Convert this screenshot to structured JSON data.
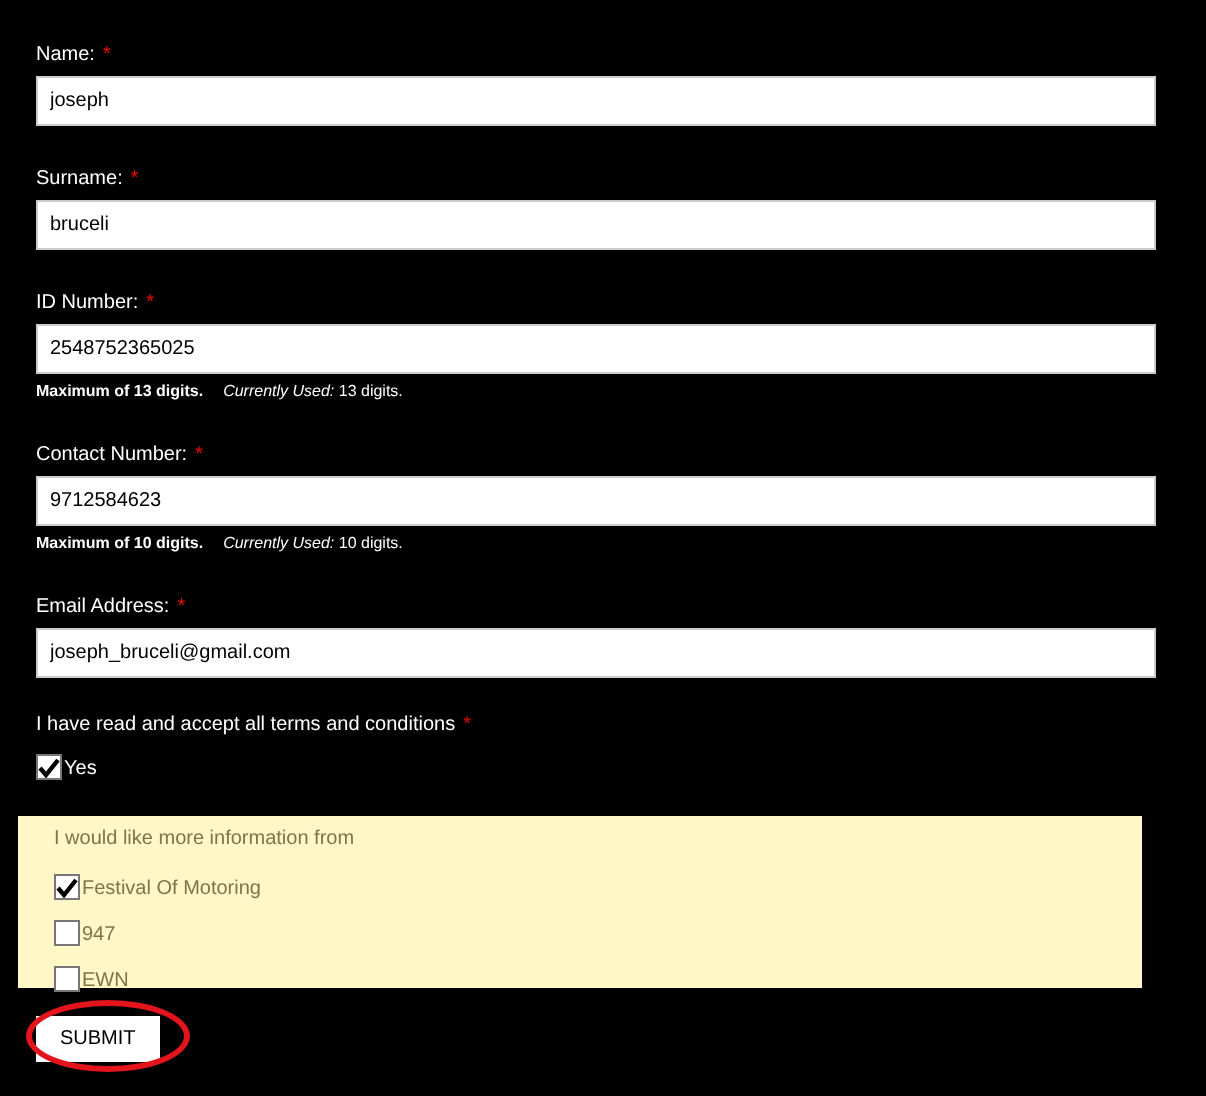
{
  "fields": [
    {
      "label": "Name:",
      "required_mark": "*",
      "value": "joseph"
    },
    {
      "label": "Surname:",
      "required_mark": "*",
      "value": "bruceli"
    },
    {
      "label": "ID Number:",
      "required_mark": "*",
      "value": "2548752365025",
      "hint": "Maximum of 13 digits.",
      "usage": "*Currently Used:* 13 digits."
    },
    {
      "label": "Contact Number:",
      "required_mark": "*",
      "value": "9712584623",
      "hint": "Maximum of 10 digits.",
      "usage": "*Currently Used:* 10 digits."
    },
    {
      "label": "Email Address:",
      "required_mark": "*",
      "value": "joseph_bruceli@gmail.com"
    }
  ],
  "terms": {
    "label": "I have read and accept all terms and conditions",
    "required_mark": "*",
    "options": [
      {
        "label": "Yes",
        "checked": true
      }
    ]
  },
  "info": {
    "label": "I would like more information from",
    "options": [
      {
        "label": "Festival Of Motoring",
        "checked": true
      },
      {
        "label": "947",
        "checked": false
      },
      {
        "label": "EWN",
        "checked": false
      }
    ]
  },
  "submit": {
    "label": "SUBMIT",
    "circled": true
  }
}
